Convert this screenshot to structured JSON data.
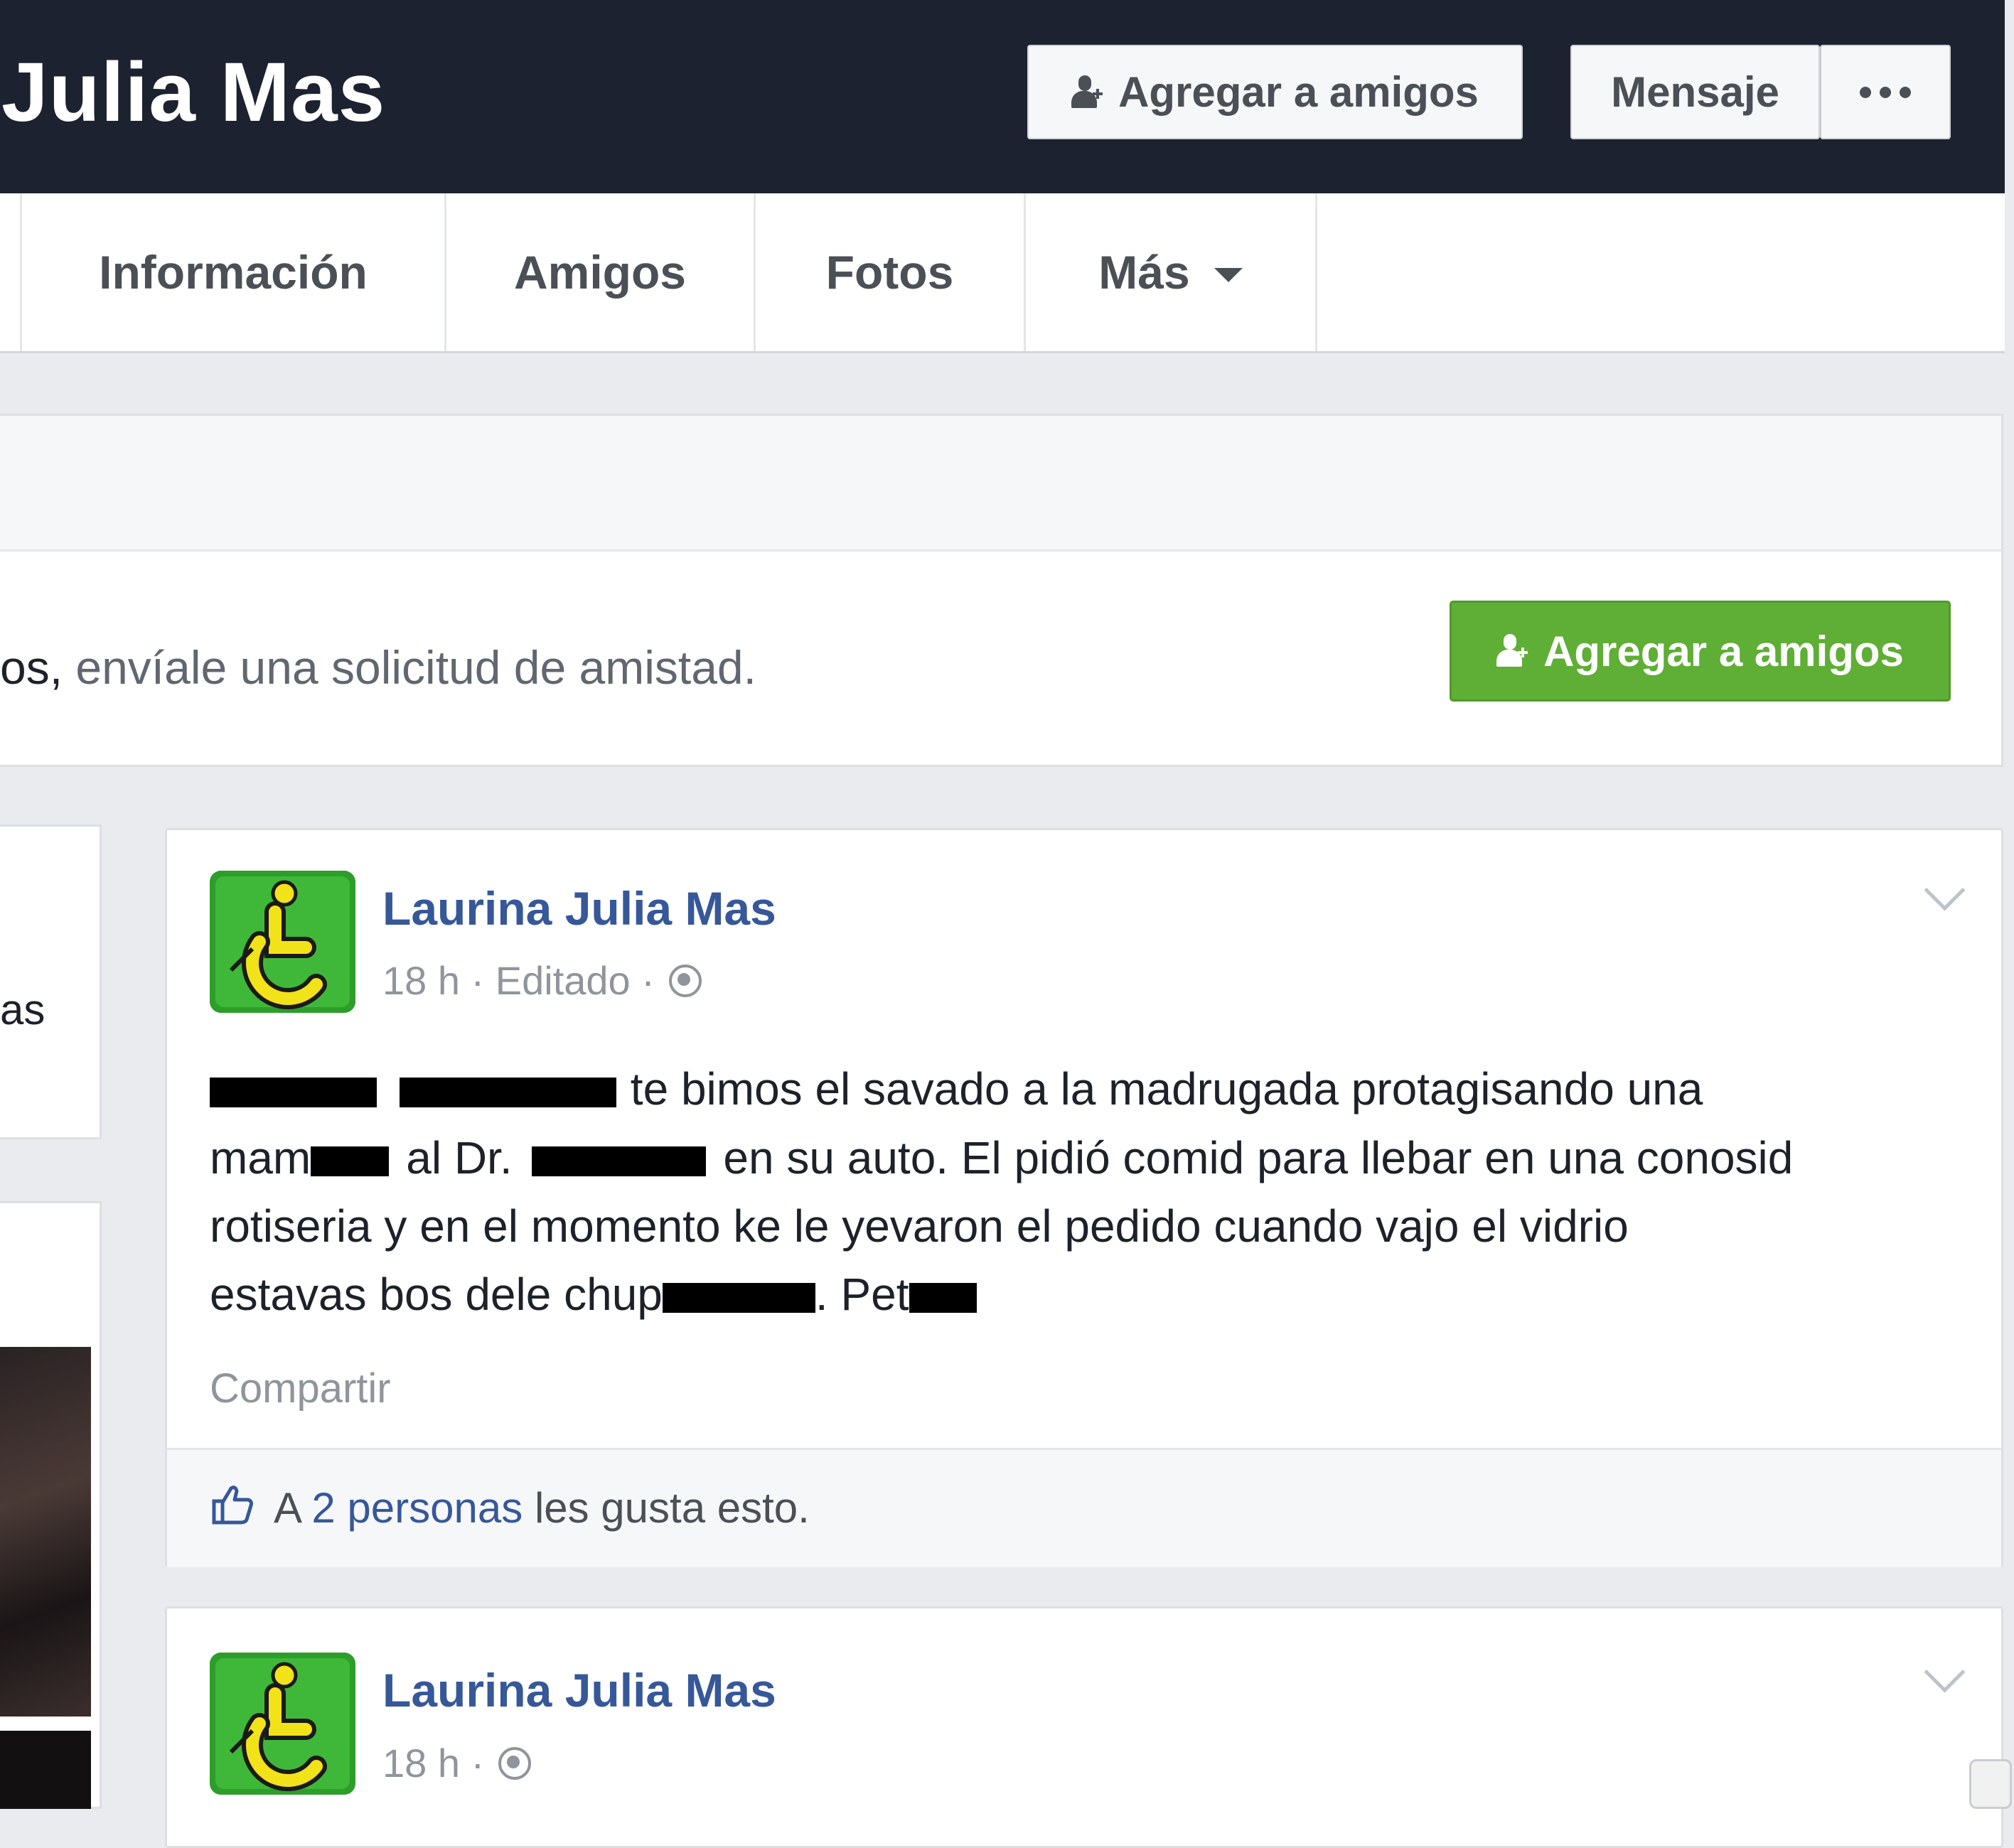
{
  "header": {
    "profile_name": "Julia Mas",
    "add_friend_label": "Agregar a amigos",
    "message_label": "Mensaje"
  },
  "tabs": [
    {
      "label": "Información"
    },
    {
      "label": "Amigos"
    },
    {
      "label": "Fotos"
    },
    {
      "label": "Más"
    }
  ],
  "banner": {
    "text_prefix": "os,",
    "text": " envíale una solicitud de amistad.",
    "add_friend_label": "Agregar a amigos"
  },
  "left_column": {
    "card_text": "as"
  },
  "posts": [
    {
      "author": "Laurina Julia Mas",
      "time": "18 h",
      "edited": "Editado",
      "lines": {
        "l1": "te bimos el savado a la madrugada protagisando una",
        "l2a": "mam",
        "l2b": "al Dr.",
        "l2c": "en su auto. El pidió comid para llebar en una conosid",
        "l3": "rotiseria y en el momento ke le yevaron el pedido cuando vajo el vidrio",
        "l4a": "estavas bos dele chup",
        "l4b": ". Pet"
      },
      "share_label": "Compartir",
      "likes": {
        "prefix": "A",
        "count": "2 personas",
        "suffix": "les gusta esto."
      }
    },
    {
      "author": "Laurina Julia Mas",
      "time": "18 h"
    }
  ],
  "colors": {
    "header_bg": "#1d2230",
    "link_blue": "#365899",
    "green_button": "#5fae35",
    "avatar_green": "#2e9e2a",
    "avatar_yellow": "#f2e21a"
  },
  "icons": [
    "add-friend-icon",
    "more-dots-icon",
    "caret-down-icon",
    "globe-icon",
    "chevron-down-icon",
    "like-thumb-icon",
    "accessibility-avatar-icon"
  ]
}
